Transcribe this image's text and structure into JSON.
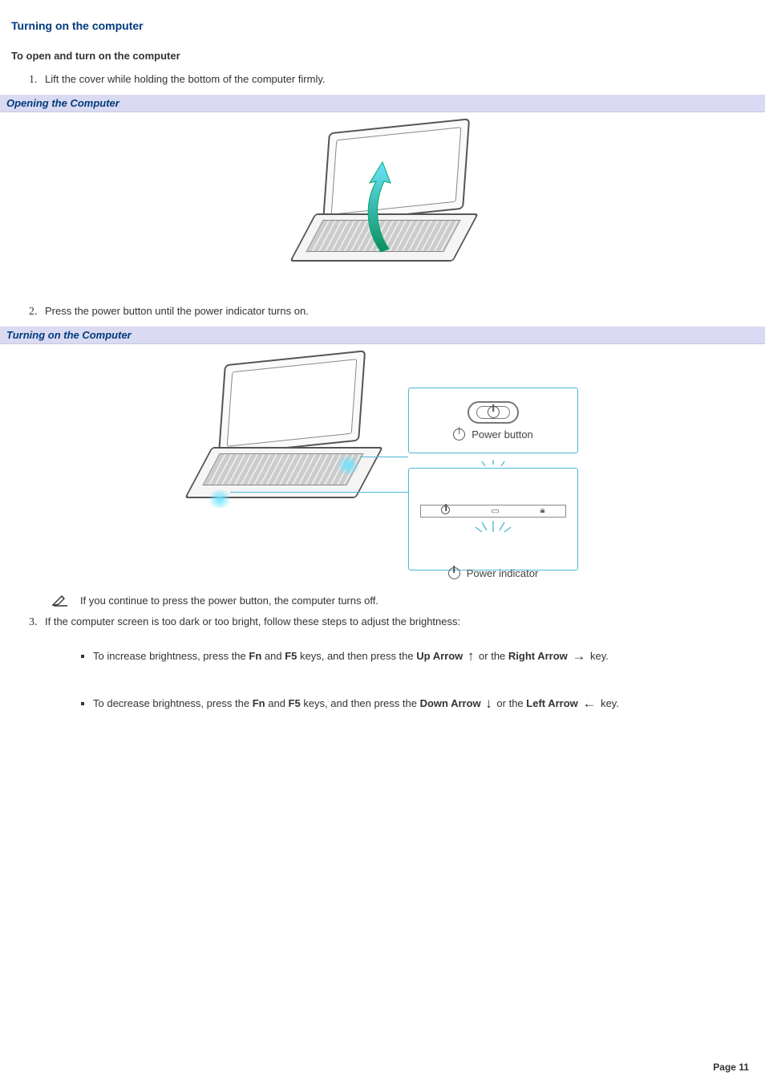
{
  "heading": "Turning on the computer",
  "subtitle": "To open and turn on the computer",
  "steps": {
    "1": "Lift the cover while holding the bottom of the computer firmly.",
    "2": "Press the power button until the power indicator turns on.",
    "3": "If the computer screen is too dark or too bright, follow these steps to adjust the brightness:"
  },
  "captions": {
    "opening": "Opening the Computer",
    "turning_on": "Turning on the Computer"
  },
  "callouts": {
    "power_button": "Power button",
    "power_indicator": "Power indicator"
  },
  "note": "If you continue to press the power button, the computer turns off.",
  "bullets": {
    "increase": {
      "pre": "To increase brightness, press the ",
      "fn": "Fn",
      "mid1": " and ",
      "f5": "F5",
      "mid2": " keys, and then press the ",
      "up_arrow": "Up Arrow",
      "or": " or the ",
      "right_arrow": "Right Arrow",
      "tail": " key."
    },
    "decrease": {
      "pre": "To decrease brightness, press the ",
      "fn": "Fn",
      "mid1": " and ",
      "f5": "F5",
      "mid2": " keys, and then press the ",
      "down_arrow": "Down Arrow",
      "or": " or the ",
      "left_arrow": "Left Arrow",
      "tail": " key."
    }
  },
  "footer": "Page 11",
  "glyphs": {
    "up": "↑",
    "right": "→",
    "down": "↓",
    "left": "←"
  }
}
